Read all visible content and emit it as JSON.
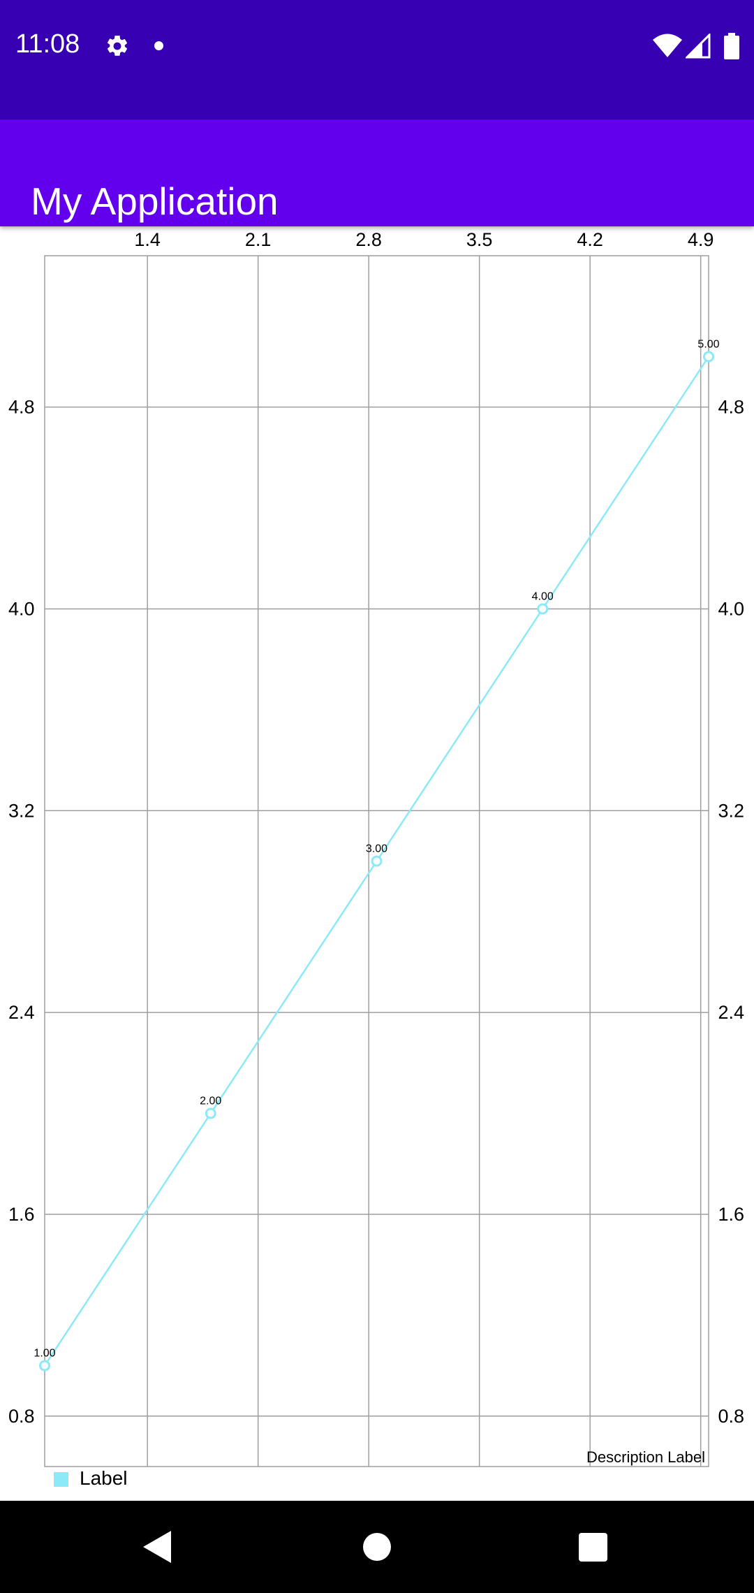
{
  "status_bar": {
    "time": "11:08",
    "icons": [
      "gear-icon",
      "notification-dot-icon",
      "wifi-icon",
      "cell-signal-icon",
      "battery-icon"
    ]
  },
  "app_bar": {
    "title": "My Application"
  },
  "colors": {
    "status_bar": "#3700b3",
    "app_bar": "#6200ee",
    "series": "#8ce9f7",
    "grid": "#9e9e9e"
  },
  "chart_data": {
    "type": "line",
    "x_axis": {
      "position": "top",
      "ticks": [
        "1.4",
        "2.1",
        "2.8",
        "3.5",
        "4.2",
        "4.9"
      ],
      "range": [
        0.75,
        4.95
      ]
    },
    "y_axis_left": {
      "ticks": [
        "0.8",
        "1.6",
        "2.4",
        "3.2",
        "4.0",
        "4.8"
      ],
      "range": [
        0.6,
        5.4
      ]
    },
    "y_axis_right": {
      "ticks": [
        "0.8",
        "1.6",
        "2.4",
        "3.2",
        "4.0",
        "4.8"
      ],
      "range": [
        0.6,
        5.4
      ]
    },
    "grid": true,
    "series": [
      {
        "name": "Label",
        "color": "#8ce9f7",
        "points": [
          {
            "x": 0.75,
            "y": 1.0,
            "label": "1.00"
          },
          {
            "x": 1.8,
            "y": 2.0,
            "label": "2.00"
          },
          {
            "x": 2.85,
            "y": 3.0,
            "label": "3.00"
          },
          {
            "x": 3.9,
            "y": 4.0,
            "label": "4.00"
          },
          {
            "x": 4.95,
            "y": 5.0,
            "label": "5.00"
          }
        ]
      }
    ],
    "legend": {
      "position": "bottom-left",
      "entries": [
        "Label"
      ]
    },
    "description": "Description Label"
  }
}
